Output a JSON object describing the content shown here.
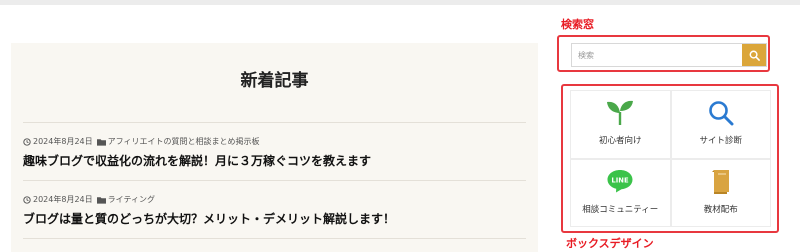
{
  "main": {
    "title": "新着記事",
    "posts": [
      {
        "date": "2024年8月24日",
        "category": "アフィリエイトの質問と相談まとめ掲示板",
        "title": "趣味ブログで収益化の流れを解説！月に３万稼ぐコツを教えます"
      },
      {
        "date": "2024年8月24日",
        "category": "ライティング",
        "title": "ブログは量と質のどっちが大切？メリット・デメリット解説します！"
      }
    ]
  },
  "annotations": {
    "search_label": "検索窓",
    "box_label": "ボックスデザイン",
    "color": "#e81c24"
  },
  "search": {
    "placeholder": "検索",
    "button_icon": "search-icon",
    "button_color": "#dba63a"
  },
  "boxes": [
    {
      "label": "初心者向け",
      "icon": "sprout-icon"
    },
    {
      "label": "サイト診断",
      "icon": "search-icon"
    },
    {
      "label": "相談コミュニティー",
      "icon": "line-chat-icon",
      "icon_text": "LINE"
    },
    {
      "label": "教材配布",
      "icon": "book-icon"
    }
  ]
}
